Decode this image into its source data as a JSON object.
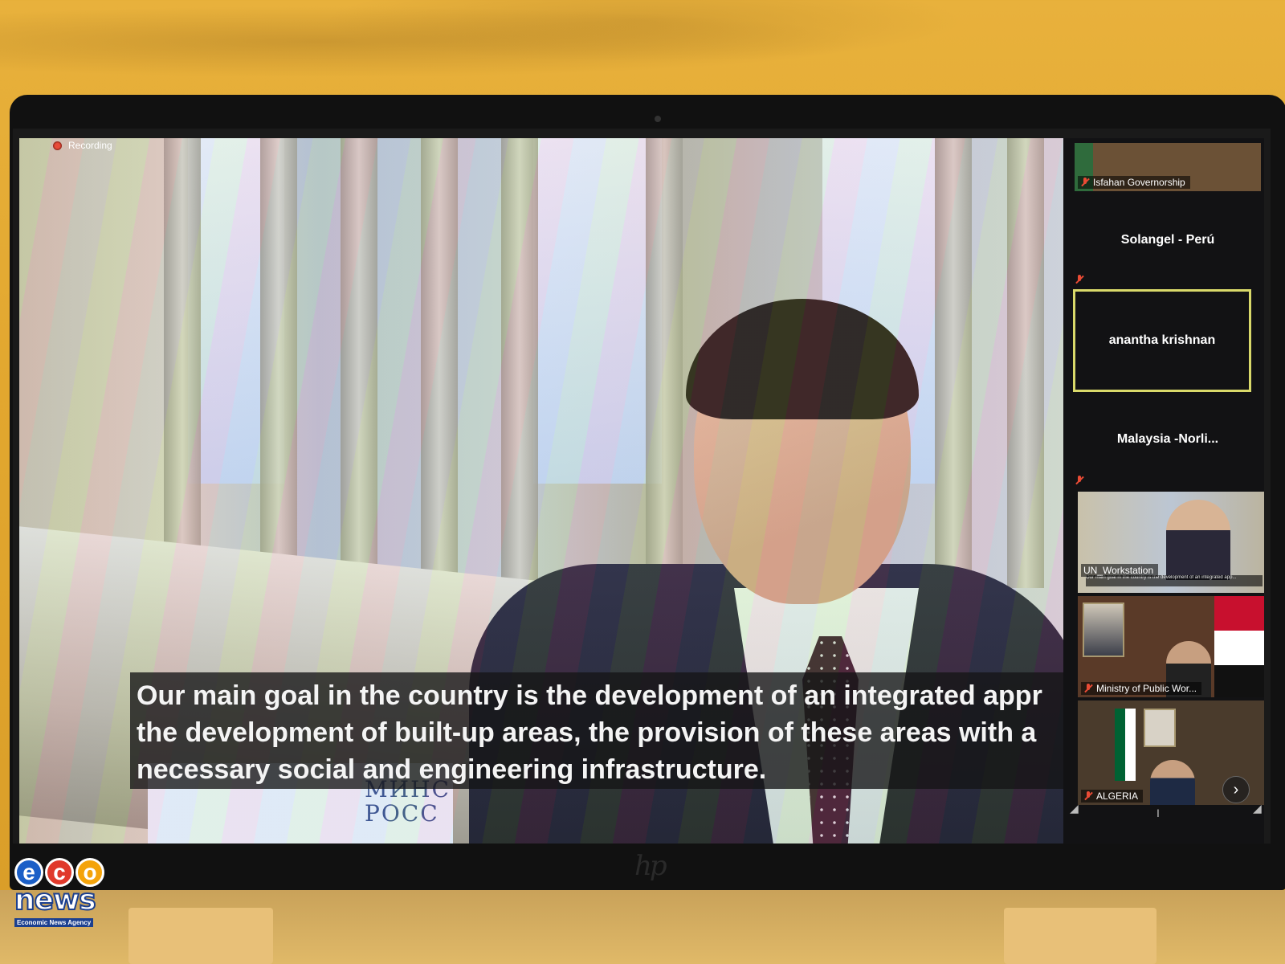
{
  "recording": {
    "label": "Recording"
  },
  "caption": {
    "lines": [
      "Our main goal in the country is the development of an integrated appr",
      "the development of built-up areas, the provision of these areas with a",
      "necessary social and engineering infrastructure."
    ]
  },
  "background_sign": {
    "line1": "МИНС",
    "line2": "РОСС"
  },
  "participants": [
    {
      "name": "Isfahan Governorship",
      "has_video": true,
      "muted": true
    },
    {
      "name": "Solangel - Perú",
      "has_video": false,
      "muted": true
    },
    {
      "name": "anantha krishnan",
      "has_video": false,
      "muted": false,
      "active_speaker": true
    },
    {
      "name": "Malaysia  -Norli...",
      "has_video": false,
      "muted": true
    },
    {
      "name": "UN_Workstation",
      "has_video": true,
      "muted": false
    },
    {
      "name": "Ministry of Public Wor...",
      "has_video": true,
      "muted": true
    },
    {
      "name": "ALGERIA",
      "has_video": true,
      "muted": true
    }
  ],
  "mini_caption": "Our main goal in the country is the development of an integrated app...",
  "controls": {
    "next_page_glyph": "›"
  },
  "laptop": {
    "brand": "hp"
  },
  "watermark": {
    "eco_letters": [
      "e",
      "c",
      "o"
    ],
    "news": "news",
    "tagline": "Economic News Agency",
    "colors": [
      "#1b5fc7",
      "#e0392b",
      "#f4a30a"
    ]
  }
}
